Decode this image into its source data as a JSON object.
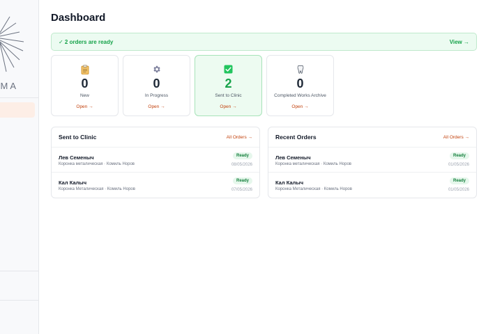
{
  "sidebar": {
    "logo_text": "МА"
  },
  "page": {
    "title": "Dashboard"
  },
  "alert": {
    "text": "✓ 2 orders are ready",
    "link": "View →"
  },
  "stats": [
    {
      "icon": "clipboard-icon",
      "value": "0",
      "label": "New",
      "link": "Open →"
    },
    {
      "icon": "gear-icon",
      "value": "0",
      "label": "In Progress",
      "link": "Open →"
    },
    {
      "icon": "check-box-icon",
      "value": "2",
      "label": "Sent to Clinic",
      "link": "Open →"
    },
    {
      "icon": "tooth-icon",
      "value": "0",
      "label": "Completed Works Archive",
      "link": "Open →"
    }
  ],
  "panels": {
    "sent": {
      "title": "Sent to Clinic",
      "link": "All Orders →",
      "orders": [
        {
          "name": "Лев Семеныч",
          "desc": "Коронка металическая · Комиль Норов",
          "status": "Ready",
          "date": "08/05/2026"
        },
        {
          "name": "Кал Калыч",
          "desc": "Коронка Металическая · Комиль Норов",
          "status": "Ready",
          "date": "07/05/2026"
        }
      ]
    },
    "recent": {
      "title": "Recent Orders",
      "link": "All Orders →",
      "orders": [
        {
          "name": "Лев Семеныч",
          "desc": "Коронка металическая · Комиль Норов",
          "status": "Ready",
          "date": "01/05/2026"
        },
        {
          "name": "Кал Калыч",
          "desc": "Коронка Металическая · Комиль Норов",
          "status": "Ready",
          "date": "01/05/2026"
        }
      ]
    }
  },
  "colors": {
    "accent": "#c2410c",
    "success": "#16a34a",
    "success_bg": "#ecfbf1"
  }
}
